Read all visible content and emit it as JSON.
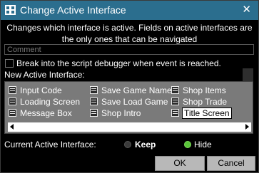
{
  "window": {
    "title": "Change Active Interface",
    "close_glyph": "✕",
    "app_icon": "script-window-icon"
  },
  "description": "Changes which interface is active. Fields on active interfaces are the only ones that can be navigated",
  "comment": {
    "placeholder": "Comment",
    "value": ""
  },
  "debugger": {
    "label": "Break into the script debugger when event is reached.",
    "checked": false
  },
  "new_interface": {
    "label": "New Active Interface:",
    "item_icon": "interface-icon",
    "columns": [
      [
        "Input Code",
        "Loading Screen",
        "Message Box"
      ],
      [
        "Save Game Name",
        "Save Load Game",
        "Shop Intro"
      ],
      [
        "Shop Items",
        "Shop Trade",
        "Title Screen"
      ]
    ],
    "selected": "Title Screen"
  },
  "current_interface": {
    "label": "Current Active Interface:",
    "options": [
      "Keep",
      "Hide"
    ],
    "selected": "Hide"
  },
  "buttons": {
    "ok": "OK",
    "cancel": "Cancel"
  },
  "colors": {
    "titlebar": "#2b6e8e",
    "list_background": "#7a7a7a",
    "hide_radio": "#5ac43a"
  }
}
